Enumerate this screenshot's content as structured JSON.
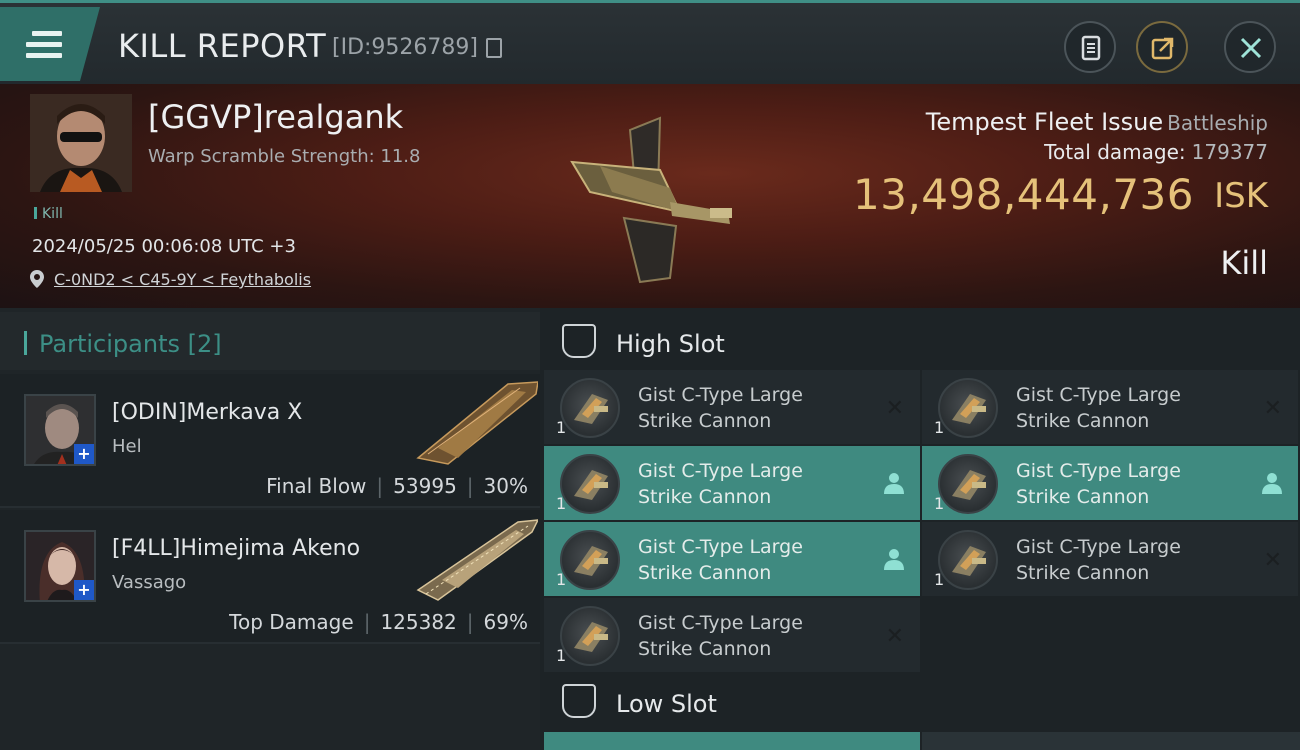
{
  "header": {
    "title": "KILL REPORT",
    "report_id": "[ID:9526789]",
    "icons": [
      "menu-icon",
      "copy-icon",
      "document-icon",
      "share-icon",
      "close-icon"
    ]
  },
  "victim": {
    "name": "[GGVP]realgank",
    "scramble": "Warp Scramble Strength: 11.8",
    "tag": "Kill",
    "time": "2024/05/25 00:06:08 UTC +3",
    "location": "C-0ND2 < C45-9Y < Feythabolis",
    "ship_name": "Tempest Fleet Issue",
    "ship_class": "Battleship",
    "total_damage_label": "Total damage:",
    "total_damage": "179377",
    "isk_value": "13,498,444,736",
    "isk_unit": "ISK",
    "result": "Kill"
  },
  "participants": {
    "title": "Participants [2]",
    "items": [
      {
        "name": "[ODIN]Merkava X",
        "ship": "Hel",
        "role": "Final Blow",
        "damage": "53995",
        "percent": "30%"
      },
      {
        "name": "[F4LL]Himejima Akeno",
        "ship": "Vassago",
        "role": "Top Damage",
        "damage": "125382",
        "percent": "69%"
      }
    ]
  },
  "fitting": {
    "high_slot": {
      "title": "High Slot",
      "modules": [
        {
          "name": "Gist C-Type Large Strike Cannon",
          "qty": "1",
          "state": "destroyed"
        },
        {
          "name": "Gist C-Type Large Strike Cannon",
          "qty": "1",
          "state": "destroyed"
        },
        {
          "name": "Gist C-Type Large Strike Cannon",
          "qty": "1",
          "state": "dropped"
        },
        {
          "name": "Gist C-Type Large Strike Cannon",
          "qty": "1",
          "state": "dropped"
        },
        {
          "name": "Gist C-Type Large Strike Cannon",
          "qty": "1",
          "state": "dropped"
        },
        {
          "name": "Gist C-Type Large Strike Cannon",
          "qty": "1",
          "state": "destroyed"
        },
        {
          "name": "Gist C-Type Large Strike Cannon",
          "qty": "1",
          "state": "destroyed"
        }
      ]
    },
    "low_slot": {
      "title": "Low Slot"
    }
  },
  "colors": {
    "accent": "#3f8a80",
    "isk": "#e5c17a",
    "banner": "#4d1d15"
  }
}
